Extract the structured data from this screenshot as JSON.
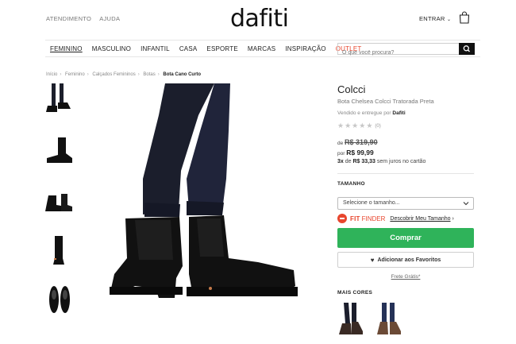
{
  "header": {
    "top_links": [
      "ATENDIMENTO",
      "AJUDA"
    ],
    "logo": "dafiti",
    "login": "ENTRAR",
    "bag_icon": "shopping-bag-icon"
  },
  "nav": {
    "items": [
      "FEMININO",
      "MASCULINO",
      "INFANTIL",
      "CASA",
      "ESPORTE",
      "MARCAS",
      "INSPIRAÇÃO",
      "OUTLET"
    ],
    "active": "FEMININO",
    "accent_color": "#e8462e",
    "search_placeholder": "O que você procura?",
    "search_icon": "search-icon"
  },
  "breadcrumb": [
    "Início",
    "Feminino",
    "Calçados Femininos",
    "Botas",
    "Bota Cano Curto"
  ],
  "product": {
    "brand": "Colcci",
    "name": "Bota Chelsea Colcci Tratorada Preta",
    "sold_by_prefix": "Vendido e entregue por",
    "sold_by": "Dafiti",
    "rating_count": "(0)",
    "price_old_prefix": "de",
    "price_old": "R$ 319,90",
    "price_new_prefix": "por",
    "price_new": "R$ 99,99",
    "installments_count": "3x",
    "installments_mid": "de",
    "installments_value": "R$ 33,33",
    "installments_suffix": "sem juros no cartão",
    "size_label": "TAMANHO",
    "size_placeholder": "Selecione o tamanho...",
    "fit_brand_a": "FIT",
    "fit_brand_b": "FINDER",
    "fit_link": "Descobrir Meu Tamanho",
    "buy_label": "Comprar",
    "buy_color": "#2fb35a",
    "fav_label": "Adicionar aos Favoritos",
    "frete_label": "Frete Grátis*",
    "more_colors_label": "MAIS CORES"
  }
}
